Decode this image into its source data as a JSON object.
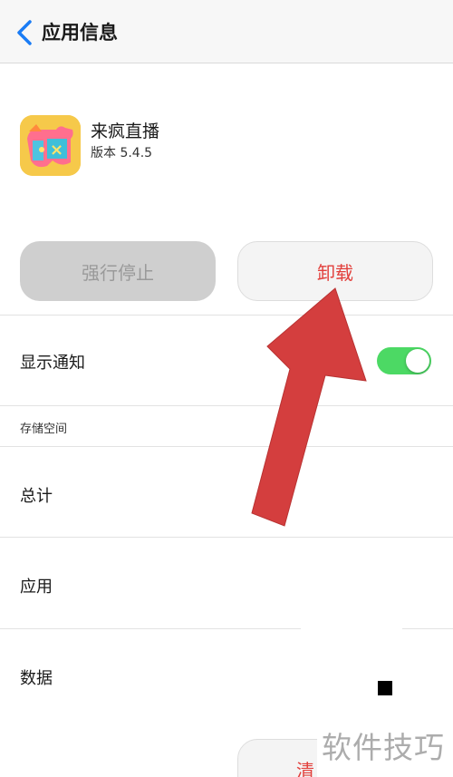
{
  "header": {
    "title": "应用信息",
    "back_icon": "chevron-left-icon"
  },
  "app": {
    "name": "来疯直播",
    "version": "版本 5.4.5",
    "icon": "laifeng-app-logo"
  },
  "actions": {
    "force_stop_label": "强行停止",
    "uninstall_label": "卸载"
  },
  "notifications": {
    "label": "显示通知",
    "enabled": true
  },
  "storage": {
    "section_label": "存储空间",
    "rows": [
      {
        "label": "总计"
      },
      {
        "label": "应用"
      },
      {
        "label": "数据"
      }
    ],
    "clear_label": "清"
  },
  "overlay": {
    "watermark": "软件技巧",
    "arrow_color": "#d43e3e"
  },
  "colors": {
    "accent_blue": "#1a7cf5",
    "danger_red": "#e2403c",
    "toggle_green": "#4cd964",
    "icon_yellow": "#f6c94a"
  }
}
